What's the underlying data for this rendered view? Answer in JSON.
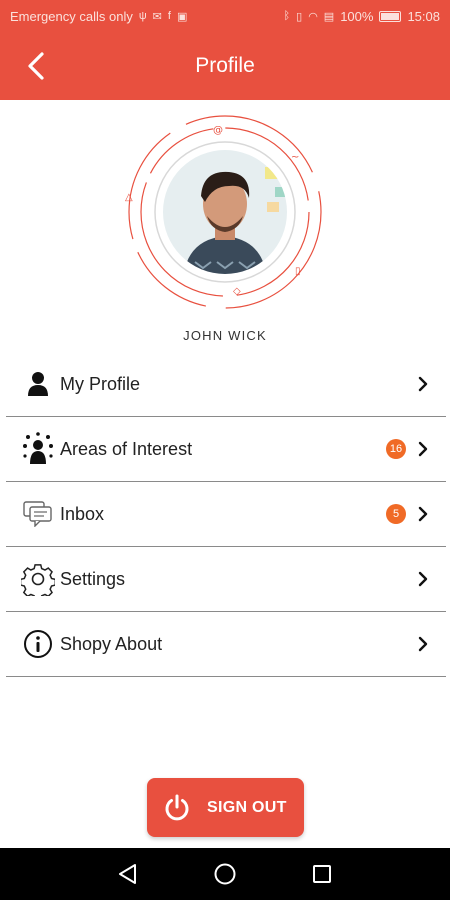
{
  "status_bar": {
    "carrier_text": "Emergency calls only",
    "battery": "100%",
    "time": "15:08"
  },
  "app_bar": {
    "title": "Profile",
    "back_icon": "chevron-left-icon"
  },
  "profile": {
    "name": "JOHN  WICK"
  },
  "menu": [
    {
      "label": "My Profile",
      "icon": "person-icon",
      "badge": null
    },
    {
      "label": "Areas of Interest",
      "icon": "interests-icon",
      "badge": "16"
    },
    {
      "label": "Inbox",
      "icon": "chat-icon",
      "badge": "5"
    },
    {
      "label": "Settings",
      "icon": "gear-icon",
      "badge": null
    },
    {
      "label": "Shopy About",
      "icon": "info-icon",
      "badge": null
    }
  ],
  "sign_out": {
    "label": "SIGN OUT",
    "icon": "power-icon"
  },
  "colors": {
    "primary": "#e8503f",
    "badge": "#f06a26"
  }
}
